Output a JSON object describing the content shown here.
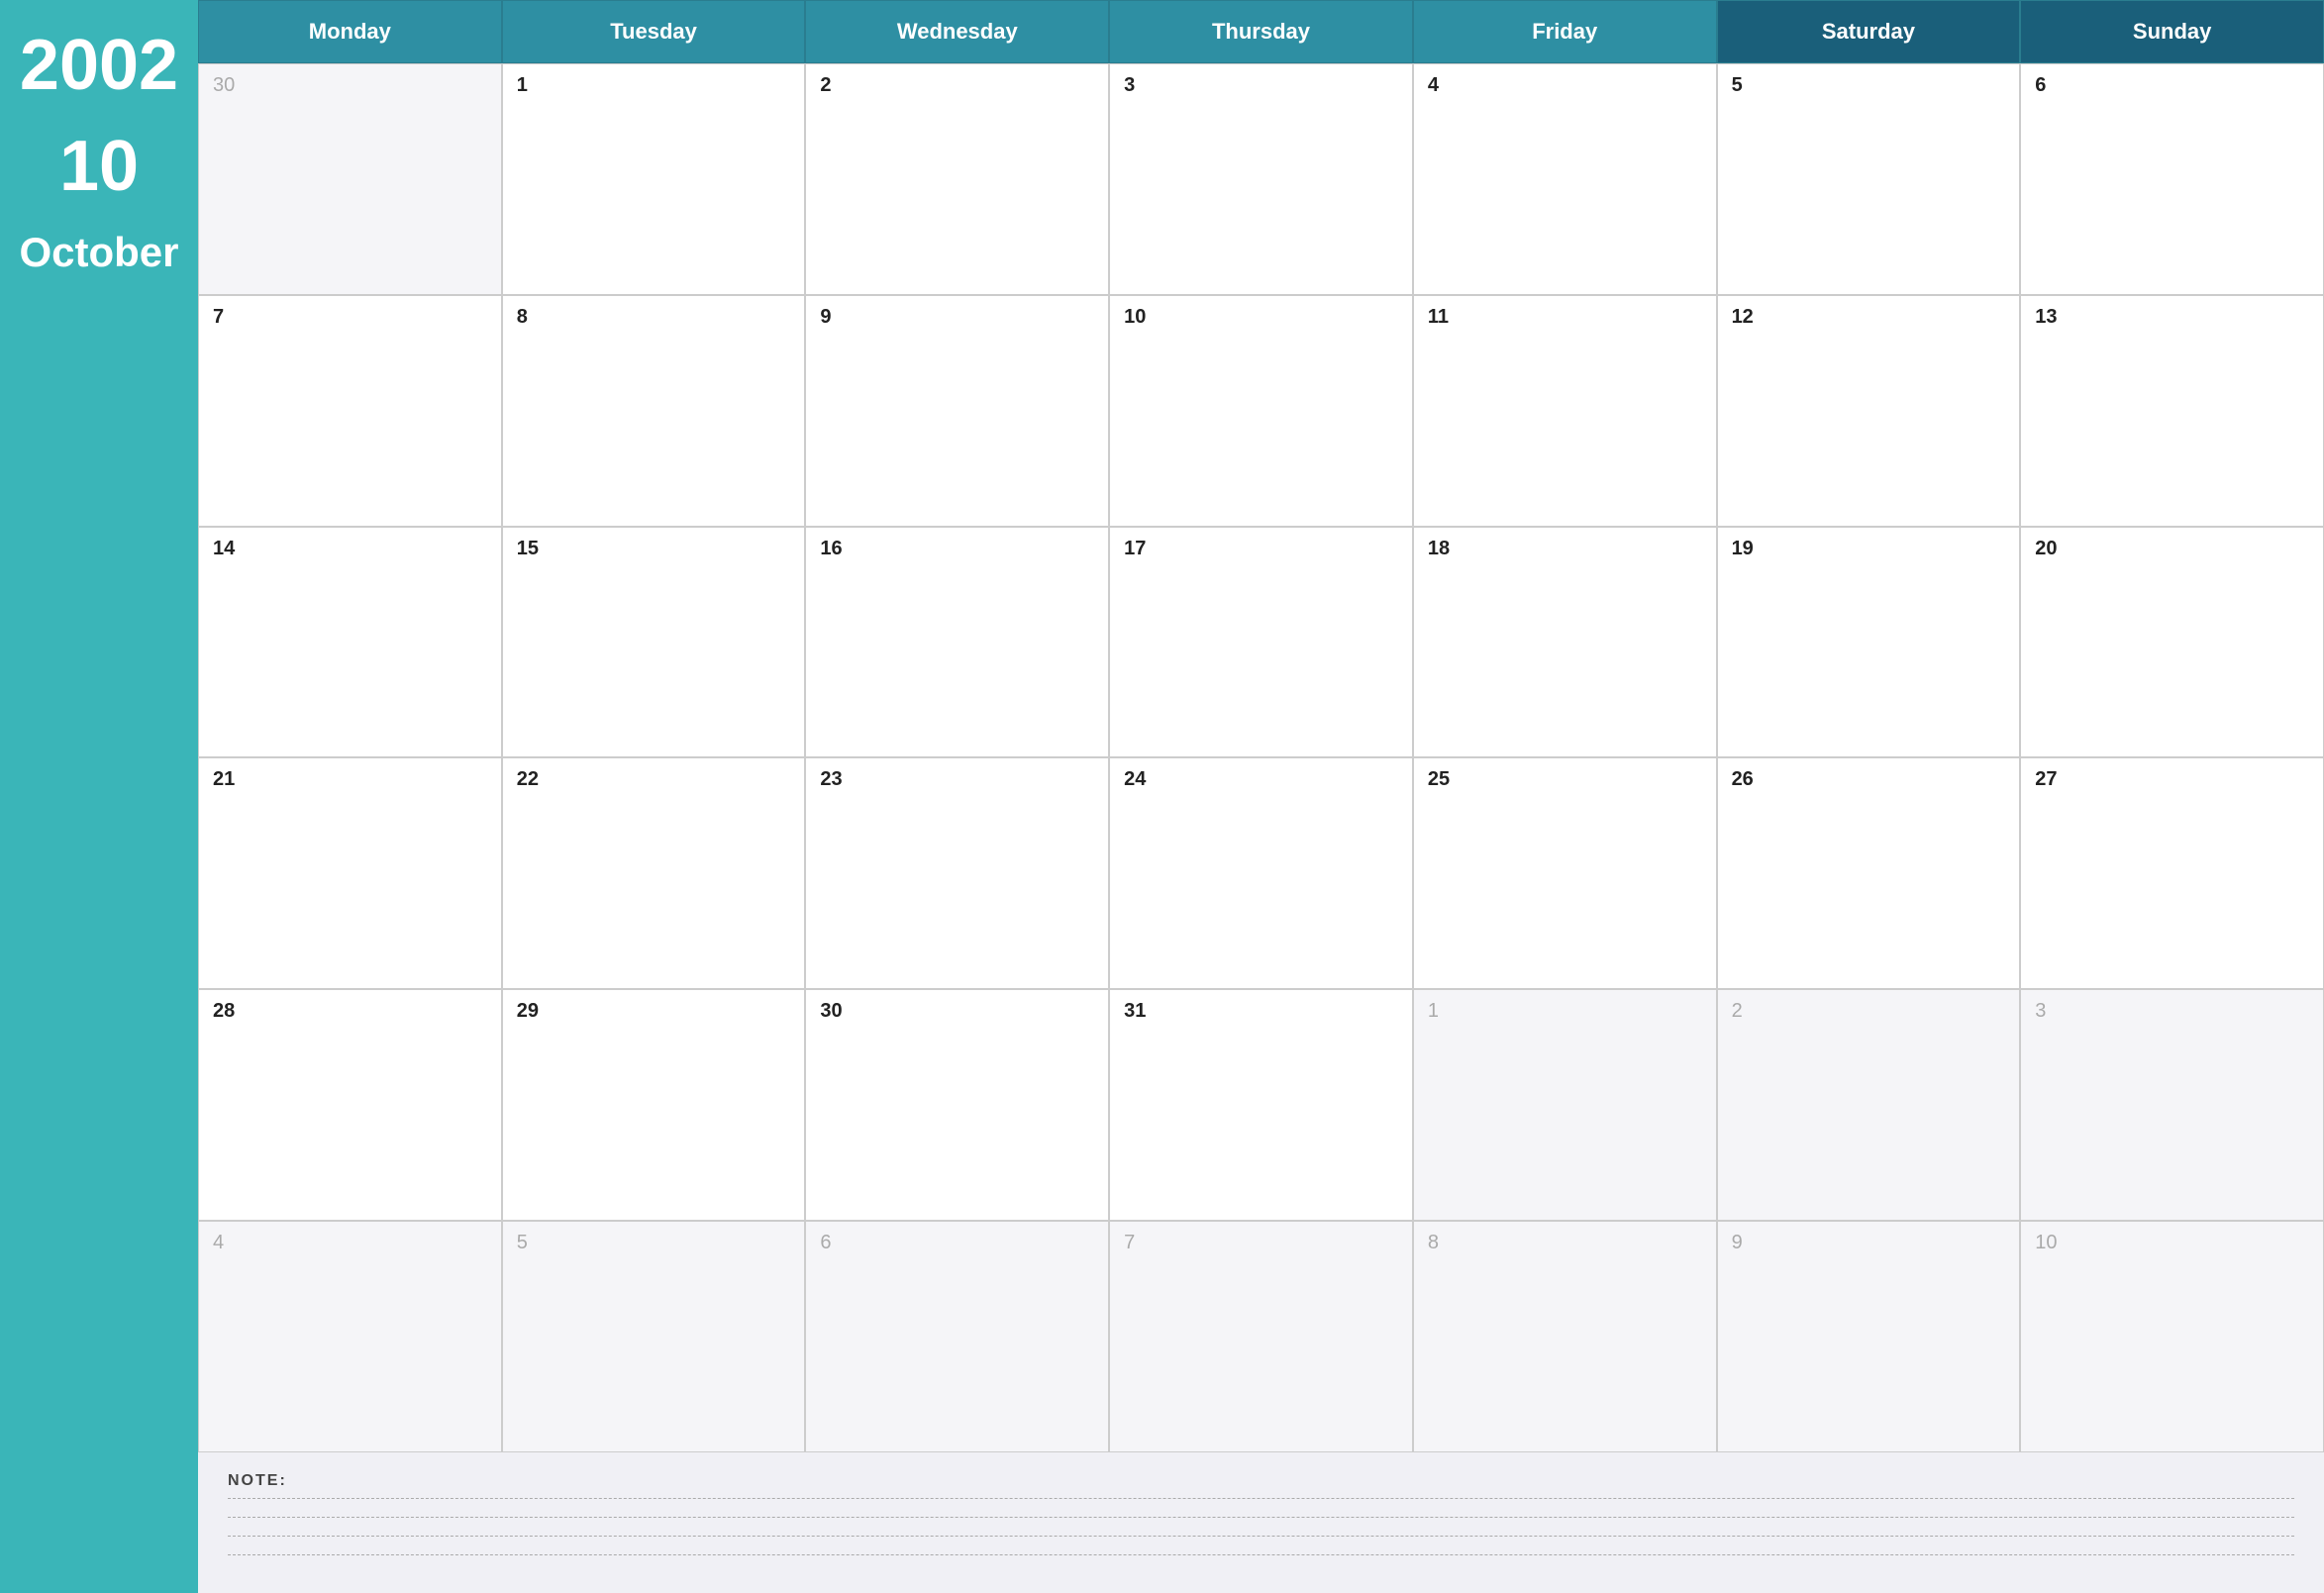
{
  "sidebar": {
    "year": "2002",
    "week_number": "10",
    "month": "October"
  },
  "header": {
    "days": [
      {
        "label": "Monday",
        "type": "weekday"
      },
      {
        "label": "Tuesday",
        "type": "weekday"
      },
      {
        "label": "Wednesday",
        "type": "weekday"
      },
      {
        "label": "Thursday",
        "type": "weekday"
      },
      {
        "label": "Friday",
        "type": "weekday"
      },
      {
        "label": "Saturday",
        "type": "weekend"
      },
      {
        "label": "Sunday",
        "type": "weekend"
      }
    ]
  },
  "weeks": [
    [
      {
        "number": "30",
        "current": false
      },
      {
        "number": "1",
        "current": true
      },
      {
        "number": "2",
        "current": true
      },
      {
        "number": "3",
        "current": true
      },
      {
        "number": "4",
        "current": true
      },
      {
        "number": "5",
        "current": true
      },
      {
        "number": "6",
        "current": true
      }
    ],
    [
      {
        "number": "7",
        "current": true
      },
      {
        "number": "8",
        "current": true
      },
      {
        "number": "9",
        "current": true
      },
      {
        "number": "10",
        "current": true
      },
      {
        "number": "11",
        "current": true
      },
      {
        "number": "12",
        "current": true
      },
      {
        "number": "13",
        "current": true
      }
    ],
    [
      {
        "number": "14",
        "current": true
      },
      {
        "number": "15",
        "current": true
      },
      {
        "number": "16",
        "current": true
      },
      {
        "number": "17",
        "current": true
      },
      {
        "number": "18",
        "current": true
      },
      {
        "number": "19",
        "current": true
      },
      {
        "number": "20",
        "current": true
      }
    ],
    [
      {
        "number": "21",
        "current": true
      },
      {
        "number": "22",
        "current": true
      },
      {
        "number": "23",
        "current": true
      },
      {
        "number": "24",
        "current": true
      },
      {
        "number": "25",
        "current": true
      },
      {
        "number": "26",
        "current": true
      },
      {
        "number": "27",
        "current": true
      }
    ],
    [
      {
        "number": "28",
        "current": true
      },
      {
        "number": "29",
        "current": true
      },
      {
        "number": "30",
        "current": true
      },
      {
        "number": "31",
        "current": true
      },
      {
        "number": "1",
        "current": false
      },
      {
        "number": "2",
        "current": false
      },
      {
        "number": "3",
        "current": false
      }
    ],
    [
      {
        "number": "4",
        "current": false
      },
      {
        "number": "5",
        "current": false
      },
      {
        "number": "6",
        "current": false
      },
      {
        "number": "7",
        "current": false
      },
      {
        "number": "8",
        "current": false
      },
      {
        "number": "9",
        "current": false
      },
      {
        "number": "10",
        "current": false
      }
    ]
  ],
  "notes": {
    "label": "NOTE:",
    "lines": 4
  }
}
